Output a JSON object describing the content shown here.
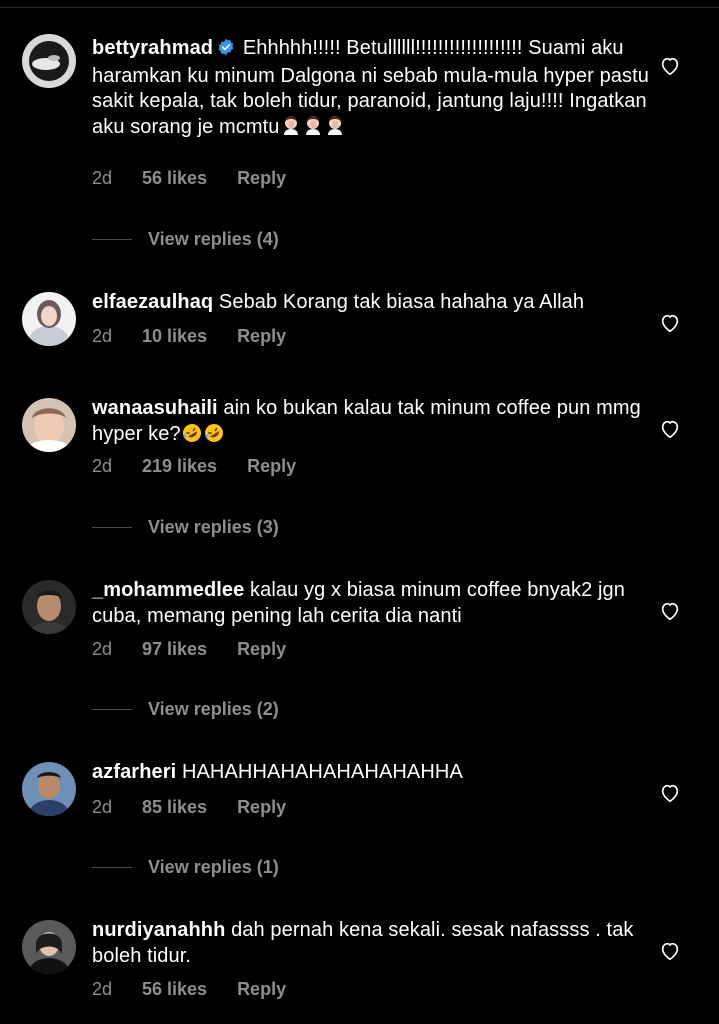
{
  "comments": [
    {
      "username": "bettyrahmad",
      "verified": true,
      "text": "Ehhhhh!!!!! Betullllll!!!!!!!!!!!!!!!!!!! Suami aku haramkan ku minum Dalgona ni sebab mula-mula hyper pastu sakit kepala, tak boleh tidur, paranoid, jantung laju!!!! Ingatkan aku sorang je mcmtu",
      "emoji_count": 3,
      "time": "2d",
      "likes": "56 likes",
      "reply": "Reply",
      "view_replies": "View replies (4)"
    },
    {
      "username": "elfaezaulhaq",
      "verified": false,
      "text": "Sebab Korang tak biasa hahaha ya Allah",
      "time": "2d",
      "likes": "10 likes",
      "reply": "Reply",
      "view_replies": ""
    },
    {
      "username": "wanaasuhaili",
      "verified": false,
      "text": "ain ko bukan kalau tak minum coffee pun mmg hyper ke?",
      "emoji_count": 2,
      "time": "2d",
      "likes": "219 likes",
      "reply": "Reply",
      "view_replies": "View replies (3)"
    },
    {
      "username": "_mohammedlee",
      "verified": false,
      "text": "kalau yg x biasa minum coffee bnyak2 jgn cuba, memang pening lah cerita dia nanti",
      "time": "2d",
      "likes": "97 likes",
      "reply": "Reply",
      "view_replies": "View replies (2)"
    },
    {
      "username": "azfarheri",
      "verified": false,
      "text": "HAHAHHAHAHAHAHAHAHHA",
      "time": "2d",
      "likes": "85 likes",
      "reply": "Reply",
      "view_replies": "View replies (1)"
    },
    {
      "username": "nurdiyanahhh",
      "verified": false,
      "text": "dah pernah kena sekali. sesak nafassss . tak boleh tidur.",
      "time": "2d",
      "likes": "56 likes",
      "reply": "Reply",
      "view_replies": ""
    }
  ],
  "icons": {
    "like": "heart-outline-icon",
    "verified": "verified-badge-icon"
  },
  "colors": {
    "background": "#000000",
    "text": "#ffffff",
    "muted": "#8e8e8e",
    "verified": "#3897f0"
  }
}
